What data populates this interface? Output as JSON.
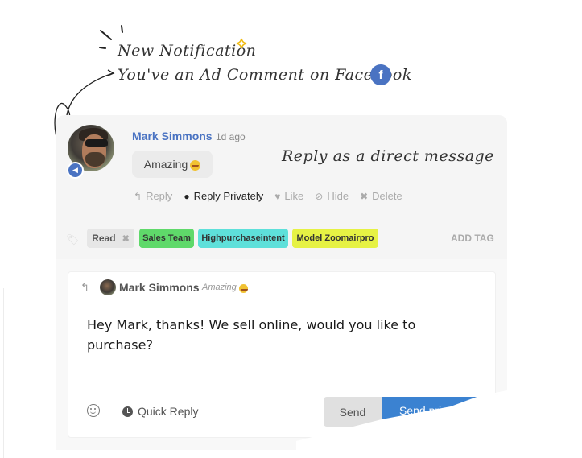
{
  "annotations": {
    "title": "New Notification",
    "subtitle": "You've an Ad Comment on Facebook",
    "hint": "Reply as a direct message",
    "facebook_icon": "facebook-icon",
    "sparkle_icon": "sparkle-icon"
  },
  "comment": {
    "author": "Mark Simmons",
    "time_ago": "1d ago",
    "text": "Amazing",
    "avatar_badge_icon": "megaphone-icon",
    "actions": [
      {
        "label": "Reply",
        "icon": "reply-icon",
        "icon_glyph": "↰"
      },
      {
        "label": "Reply Privately",
        "icon": "messenger-icon",
        "icon_glyph": "●"
      },
      {
        "label": "Like",
        "icon": "heart-icon",
        "icon_glyph": "♥"
      },
      {
        "label": "Hide",
        "icon": "eye-slash-icon",
        "icon_glyph": "⊘"
      },
      {
        "label": "Delete",
        "icon": "close-icon",
        "icon_glyph": "✖"
      }
    ]
  },
  "tags": {
    "icon": "tag-icon",
    "items": [
      {
        "label": "Read",
        "removable": true,
        "color": "#e6e6e6"
      },
      {
        "label": "Sales Team",
        "removable": false,
        "color": "#5fd96a"
      },
      {
        "label": "Highpurchaseintent",
        "removable": false,
        "color": "#5ee0da"
      },
      {
        "label": "Model Zoomairpro",
        "removable": false,
        "color": "#e6f244"
      }
    ],
    "remove_glyph": "✖",
    "add_label": "ADD TAG"
  },
  "reply": {
    "replying_to_author": "Mark Simmons",
    "replying_to_quote": "Amazing",
    "reply_icon_glyph": "↰",
    "message": "Hey Mark, thanks! We sell online, would you like to purchase?",
    "emoji_button_icon": "smiley-icon",
    "quick_reply_label": "Quick Reply",
    "send_label": "Send",
    "send_private_label": "Send privately"
  },
  "colors": {
    "brand_blue": "#4a73c2",
    "send_blue": "#3b82d1",
    "card_bg": "#f5f5f5"
  }
}
